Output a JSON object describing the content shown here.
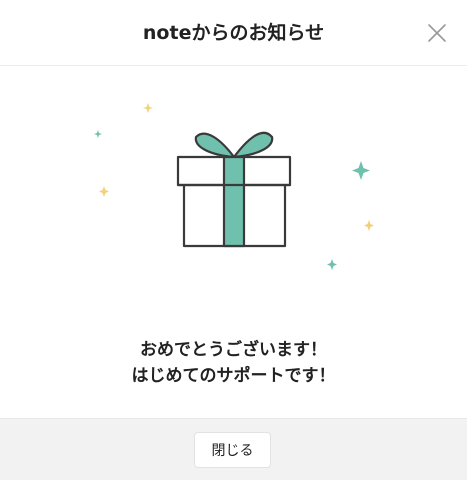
{
  "header": {
    "title": "noteからのお知らせ",
    "close_icon": "close-icon"
  },
  "illustration": {
    "icon": "gift-box-icon",
    "colors": {
      "ribbon": "#6fc1ad",
      "outline": "#3a3a3a",
      "sparkle_yellow": "#f0d27a",
      "sparkle_green": "#6fc1ad"
    }
  },
  "message": {
    "line1": "おめでとうございます！",
    "line2": "はじめてのサポートです！"
  },
  "footer": {
    "close_button_label": "閉じる",
    "background": "#f2f2f2"
  }
}
